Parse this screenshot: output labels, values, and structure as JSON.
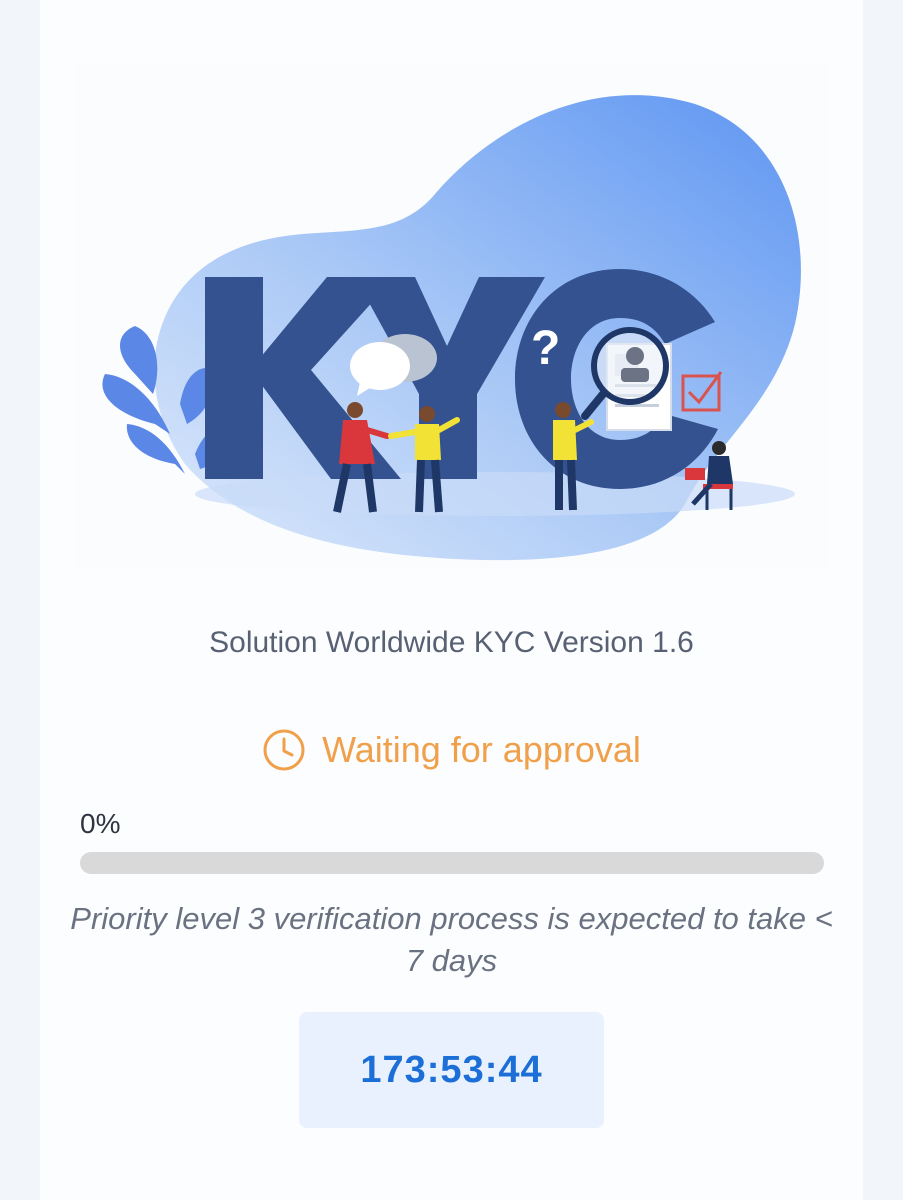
{
  "hero": {
    "illustration": "kyc-illustration",
    "letters": "KYC",
    "question_mark": "?"
  },
  "version_label": "Solution Worldwide KYC Version 1.6",
  "status": {
    "icon": "clock-icon",
    "label": "Waiting for approval",
    "color": "#f0a04b"
  },
  "progress": {
    "label": "0%",
    "value": 0
  },
  "note": "Priority level 3 verification process is expected to take < 7 days",
  "timer": "173:53:44",
  "colors": {
    "accent": "#1d6fd8",
    "status": "#f0a04b",
    "letters": "#33528f"
  }
}
